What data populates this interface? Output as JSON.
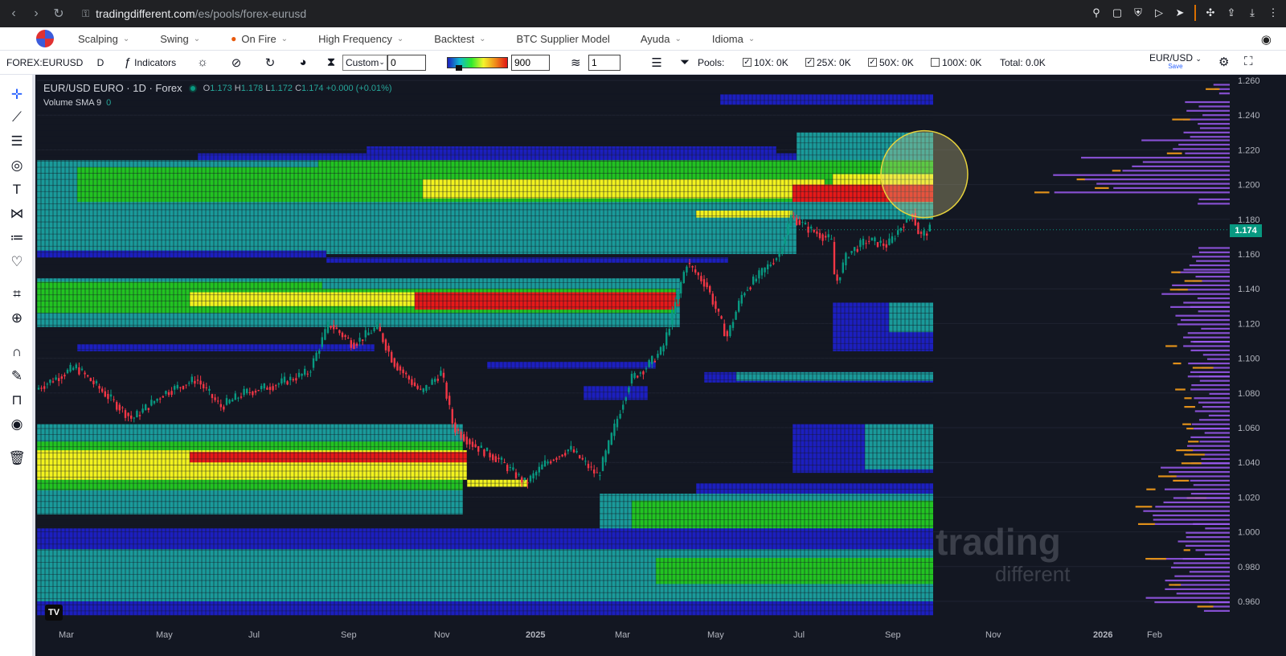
{
  "browser": {
    "url_host": "tradingdifferent.com",
    "url_path": "/es/pools/forex-eurusd"
  },
  "menu": {
    "items": [
      {
        "label": "Scalping"
      },
      {
        "label": "Swing"
      },
      {
        "label": "On Fire"
      },
      {
        "label": "High Frequency"
      },
      {
        "label": "Backtest"
      },
      {
        "label": "BTC Supplier Model"
      },
      {
        "label": "Ayuda"
      },
      {
        "label": "Idioma"
      }
    ]
  },
  "toolbar": {
    "symbol": "FOREX:EURUSD",
    "interval": "D",
    "indicators_label": "Indicators",
    "range_mode": "Custom",
    "range_value": "0",
    "threshold_value": "900",
    "layers_value": "1",
    "pools_label": "Pools:",
    "pool_10x": "10X: 0K",
    "pool_25x": "25X: 0K",
    "pool_50x": "50X: 0K",
    "pool_100x": "100X: 0K",
    "total": "Total: 0.0K",
    "pair": "EUR/USD",
    "save_label": "Save"
  },
  "legend": {
    "title": "EUR/USD EURO · 1D · Forex",
    "o_label": "O",
    "o": "1.173",
    "h_label": "H",
    "h": "1.178",
    "l_label": "L",
    "l": "1.172",
    "c_label": "C",
    "c": "1.174",
    "change": "+0.000 (+0.01%)",
    "volume_label": "Volume SMA 9",
    "volume_value": "0"
  },
  "price_axis": {
    "ticks": [
      "1.260",
      "1.240",
      "1.220",
      "1.200",
      "1.180",
      "1.160",
      "1.140",
      "1.120",
      "1.100",
      "1.080",
      "1.060",
      "1.040",
      "1.020",
      "1.000",
      "0.980",
      "0.960"
    ],
    "current_price": "1.174"
  },
  "time_axis": {
    "ticks": [
      "Mar",
      "May",
      "Jul",
      "Sep",
      "Nov",
      "2025",
      "Mar",
      "May",
      "Jul",
      "Sep",
      "Nov",
      "2026",
      "Feb"
    ]
  },
  "watermark": {
    "line1": "trading",
    "line2": "different"
  },
  "colors": {
    "bg": "#131722",
    "candle_up": "#089981",
    "candle_down": "#f23645",
    "heat_low": "#1c1fbf",
    "heat_teal": "#1a9a9a",
    "heat_green": "#22c322",
    "heat_yellow": "#f2f21f",
    "heat_red": "#e61919",
    "profile": "#9b59f0",
    "profile_orange": "#e0901a"
  }
}
